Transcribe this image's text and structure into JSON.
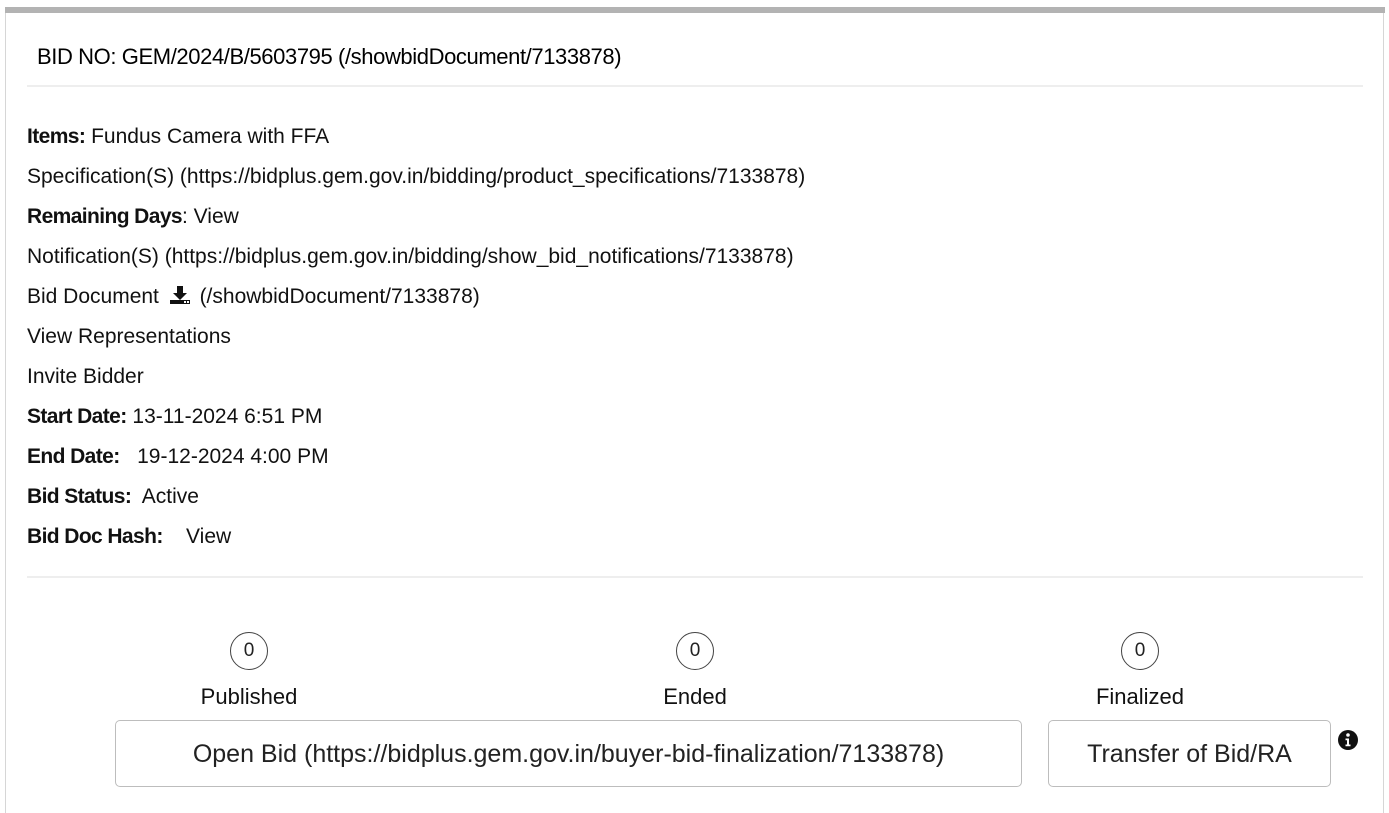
{
  "bid": {
    "title": "BID NO: GEM/2024/B/5603795 (/showbidDocument/7133878)"
  },
  "details": {
    "items_label": "Items:",
    "items_value": " Fundus Camera with FFA",
    "specification_link": "Specification(S) (https://bidplus.gem.gov.in/bidding/product_specifications/7133878)",
    "remaining_days_label": "Remaining Days",
    "remaining_days_value": ": View",
    "notification_link": "Notification(S) (https://bidplus.gem.gov.in/bidding/show_bid_notifications/7133878)",
    "bid_document_label": "Bid Document ",
    "bid_document_link": " (/showbidDocument/7133878)",
    "view_representations": "View Representations",
    "invite_bidder": "Invite Bidder",
    "start_date_label": "Start Date:",
    "start_date_value": " 13-11-2024 6:51 PM",
    "end_date_label": "End Date:",
    "end_date_value": "   19-12-2024 4:00 PM",
    "bid_status_label": "Bid Status:",
    "bid_status_value": "  Active",
    "bid_doc_hash_label": "Bid Doc Hash:",
    "bid_doc_hash_value": "    View"
  },
  "stats": {
    "published": {
      "count": "0",
      "label": "Published"
    },
    "ended": {
      "count": "0",
      "label": "Ended"
    },
    "finalized": {
      "count": "0",
      "label": "Finalized"
    }
  },
  "actions": {
    "open_bid_label": "Open Bid (https://bidplus.gem.gov.in/buyer-bid-finalization/7133878)",
    "transfer_label": "Transfer of Bid/RA"
  },
  "icons": {
    "download": "download-icon",
    "info": "info-icon"
  },
  "colors": {
    "text": "#111111",
    "border": "#bdbdbd",
    "top_bar": "#b3b3b3"
  }
}
